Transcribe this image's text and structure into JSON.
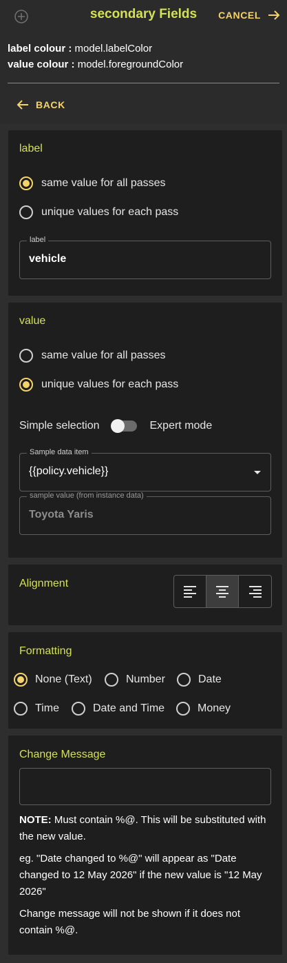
{
  "header": {
    "title": "secondary Fields",
    "cancel_label": "CANCEL"
  },
  "meta": {
    "label_colour_key": "label colour :",
    "label_colour_value": "model.labelColor",
    "value_colour_key": "value colour :",
    "value_colour_value": "model.foregroundColor"
  },
  "back_label": "BACK",
  "label_section": {
    "title": "label",
    "option_same": "same value for all passes",
    "option_unique": "unique values for each pass",
    "selected": "same",
    "field_label": "label",
    "field_value": "vehicle"
  },
  "value_section": {
    "title": "value",
    "option_same": "same value for all passes",
    "option_unique": "unique values for each pass",
    "selected": "unique",
    "toggle_left": "Simple selection",
    "toggle_right": "Expert mode",
    "sample_item_label": "Sample data item",
    "sample_item_value": "{{policy.vehicle}}",
    "sample_value_label": "sample value (from instance data)",
    "sample_value_value": "Toyota Yaris"
  },
  "alignment": {
    "title": "Alignment",
    "options": [
      "left-align-icon",
      "center-align-icon",
      "right-align-icon"
    ],
    "selected": "center"
  },
  "formatting": {
    "title": "Formatting",
    "options": [
      "None (Text)",
      "Number",
      "Date",
      "Time",
      "Date and Time",
      "Money"
    ],
    "selected": "None (Text)"
  },
  "change_message": {
    "title": "Change Message",
    "input_value": "",
    "note_bold": "NOTE:",
    "note_text": " Must contain %@. This will be substituted with the new value.",
    "example": "eg. \"Date changed to %@\" will appear as \"Date changed to 12 May 2026\" if the new value is \"12 May 2026\"",
    "warning": "Change message will not be shown if it does not contain %@."
  },
  "colors": {
    "accent_yellow": "#f5d36b",
    "title_green": "#d4e157",
    "card_bg": "#1e1e1e",
    "page_bg": "#2b2b2b"
  }
}
